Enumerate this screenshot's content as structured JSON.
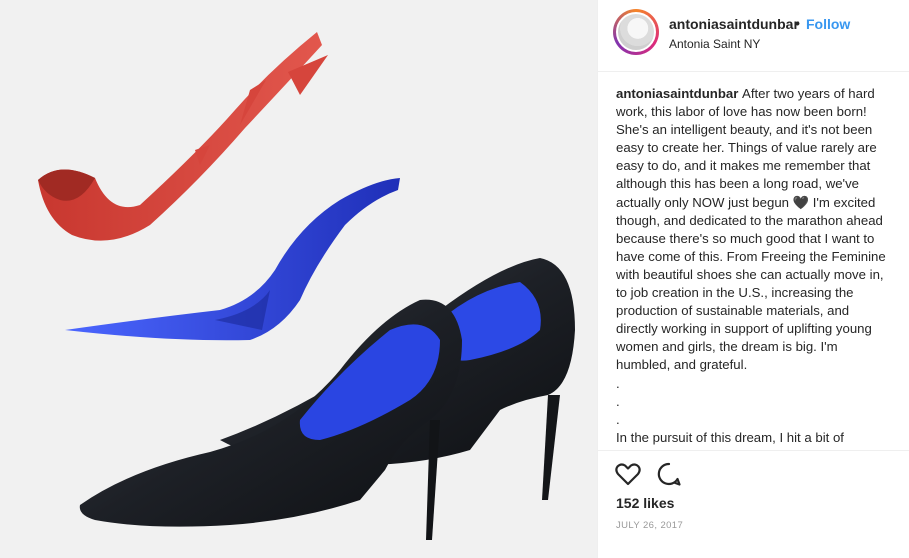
{
  "post": {
    "username": "antoniasaintdunbar",
    "separator": "•",
    "follow_label": "Follow",
    "location": "Antonia Saint NY",
    "caption_user": "antoniasaintdunbar",
    "caption_text": "After two years of hard work, this labor of love has now been born! She's an intelligent beauty, and it's not been easy to create her. Things of value rarely are easy to do, and it makes me remember that although this has been a long road, we've actually only NOW just begun 🖤 I'm excited though, and dedicated to the marathon ahead because there's so much good that I want to have come of this. From Freeing the Feminine with beautiful shoes she can actually move in, to job creation in the U.S., increasing the production of sustainable materials, and directly working in support of uplifting young women and girls, the dream is big. I'm humbled, and grateful.",
    "caption_dots": [
      ".",
      ".",
      "."
    ],
    "caption_continuation": "In the pursuit of this dream, I hit a bit of",
    "likes": "152 likes",
    "date": "JULY 26, 2017"
  },
  "icons": {
    "like": "heart-icon",
    "comment": "comment-icon"
  },
  "colors": {
    "follow": "#3897f0",
    "heel_red": "#d6453c",
    "insole_blue": "#2b3fd0",
    "shoe_black": "#1c1f24",
    "photo_bg": "#f1f1f1"
  }
}
